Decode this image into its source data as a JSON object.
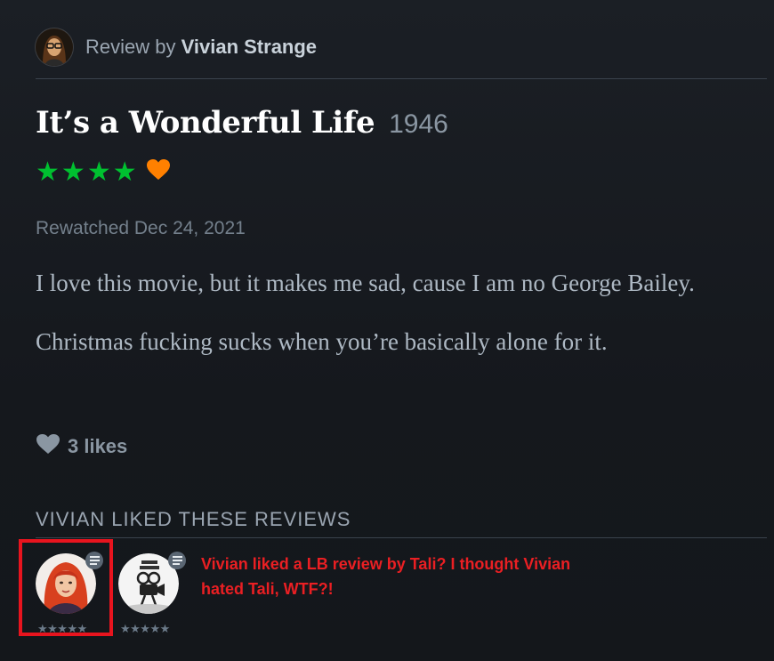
{
  "colors": {
    "background": "#1b1f25",
    "star_green": "#00c030",
    "heart_orange": "#ff8000",
    "annotation_red": "#e8141e"
  },
  "reviewer": {
    "prefix": "Review by",
    "name": "Vivian Strange",
    "avatar_icon": "reviewer-avatar"
  },
  "film": {
    "title": "It’s a Wonderful Life",
    "year": "1946"
  },
  "rating": {
    "stars": 4,
    "max_stars": 5,
    "liked": true
  },
  "watched": {
    "text": "Rewatched Dec 24, 2021"
  },
  "review": {
    "paragraphs": [
      "I love this movie, but it makes me sad, cause I am no George Bailey.",
      "Christmas fucking sucks when you’re basically alone for it."
    ]
  },
  "likes": {
    "icon": "heart-icon",
    "count_text": "3 likes"
  },
  "liked_reviews": {
    "heading": "VIVIAN LIKED THESE REVIEWS",
    "items": [
      {
        "avatar": "red-haired-user-avatar",
        "badge_icon": "review-list-icon",
        "stars_text": "★★★★★"
      },
      {
        "avatar": "movie-lover-avatar",
        "badge_icon": "review-list-icon",
        "stars_text": "★★★★★"
      }
    ]
  },
  "annotation": {
    "text": "Vivian liked a LB review by Tali? I thought Vivian hated Tali, WTF?!"
  }
}
